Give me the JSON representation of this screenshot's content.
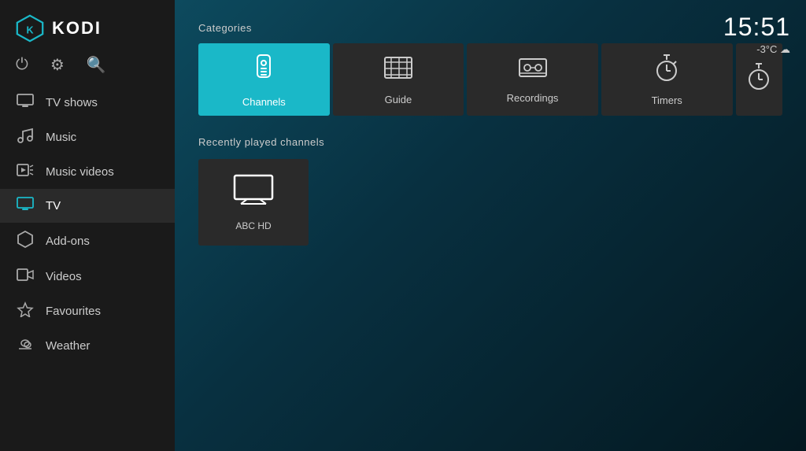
{
  "app": {
    "name": "KODI"
  },
  "sidebar": {
    "top_icons": [
      {
        "name": "power-icon",
        "symbol": "⏻",
        "label": "Power"
      },
      {
        "name": "settings-icon",
        "symbol": "⚙",
        "label": "Settings"
      },
      {
        "name": "search-icon",
        "symbol": "🔍",
        "label": "Search"
      }
    ],
    "nav_items": [
      {
        "id": "tv-shows",
        "label": "TV shows",
        "icon": "🖥"
      },
      {
        "id": "music",
        "label": "Music",
        "icon": "🎧"
      },
      {
        "id": "music-videos",
        "label": "Music videos",
        "icon": "🎵"
      },
      {
        "id": "tv",
        "label": "TV",
        "icon": "📺",
        "active": true
      },
      {
        "id": "add-ons",
        "label": "Add-ons",
        "icon": "⬡"
      },
      {
        "id": "videos",
        "label": "Videos",
        "icon": "🎞"
      },
      {
        "id": "favourites",
        "label": "Favourites",
        "icon": "★"
      },
      {
        "id": "weather",
        "label": "Weather",
        "icon": "⛅"
      }
    ]
  },
  "main": {
    "time": "15:51",
    "weather_info": "-3°C ☁",
    "categories_label": "Categories",
    "categories": [
      {
        "id": "channels",
        "label": "Channels",
        "active": true
      },
      {
        "id": "guide",
        "label": "Guide",
        "active": false
      },
      {
        "id": "recordings",
        "label": "Recordings",
        "active": false
      },
      {
        "id": "timers",
        "label": "Timers",
        "active": false
      },
      {
        "id": "timers2",
        "label": "Tim...",
        "active": false,
        "partial": true
      }
    ],
    "recently_label": "Recently played channels",
    "channels": [
      {
        "id": "abc-hd",
        "label": "ABC HD"
      }
    ]
  }
}
